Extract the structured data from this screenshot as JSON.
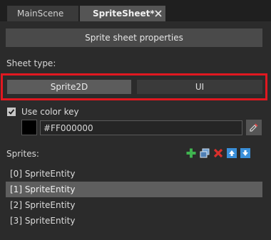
{
  "tabs": [
    {
      "label": "MainScene"
    },
    {
      "label": "SpriteSheet*"
    }
  ],
  "panel": {
    "properties_button": "Sprite sheet properties",
    "sheet_type_label": "Sheet type:",
    "sheet_types": [
      "Sprite2D",
      "UI"
    ],
    "selected_sheet_type": "Sprite2D",
    "use_color_key_label": "Use color key",
    "use_color_key_checked": true,
    "color_key_value": "#FF000000",
    "color_key_swatch": "#000000",
    "sprites_label": "Sprites:",
    "sprites": [
      "[0] SpriteEntity",
      "[1] SpriteEntity",
      "[2] SpriteEntity",
      "[3] SpriteEntity"
    ],
    "selected_sprite_index": 1
  },
  "colors": {
    "highlight": "#e11820",
    "add_green": "#3fb34f",
    "delete_red": "#d9302c",
    "arrow_blue": "#3a8fd9"
  },
  "icons": [
    "close-icon",
    "checkmark-icon",
    "eyedropper-icon",
    "add-icon",
    "duplicate-icon",
    "delete-icon",
    "move-up-icon",
    "move-down-icon"
  ]
}
